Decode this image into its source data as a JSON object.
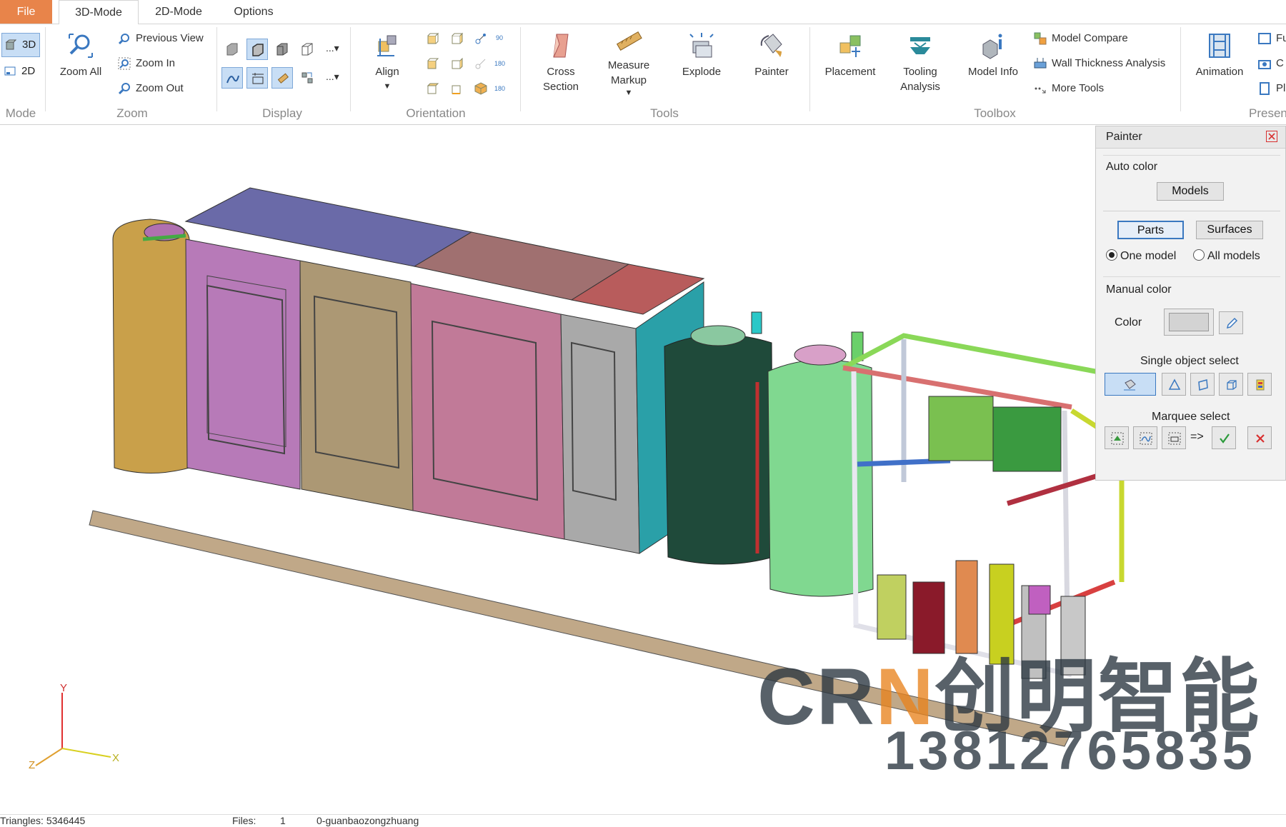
{
  "tabs": [
    {
      "label": "File"
    },
    {
      "label": "3D-Mode"
    },
    {
      "label": "2D-Mode"
    },
    {
      "label": "Options"
    }
  ],
  "ribbon": {
    "mode": {
      "label": "Mode",
      "btn_3d": "3D",
      "btn_2d": "2D"
    },
    "zoom": {
      "label": "Zoom",
      "zoom_all": "Zoom All",
      "previous_view": "Previous View",
      "zoom_in": "Zoom In",
      "zoom_out": "Zoom Out"
    },
    "display": {
      "label": "Display",
      "more": "..."
    },
    "orientation": {
      "label": "Orientation",
      "align": "Align",
      "deg90": "90",
      "deg180a": "180",
      "deg180b": "180"
    },
    "tools": {
      "label": "Tools",
      "cross_section": [
        "Cross",
        "Section"
      ],
      "measure_markup": [
        "Measure",
        "Markup"
      ],
      "explode": "Explode",
      "painter": "Painter"
    },
    "toolbox": {
      "label": "Toolbox",
      "placement": "Placement",
      "tooling_analysis": [
        "Tooling",
        "Analysis"
      ],
      "model_info": "Model Info",
      "model_compare": "Model Compare",
      "wall_thickness": "Wall Thickness Analysis",
      "more_tools": "More Tools"
    },
    "presentation": {
      "label": "Present",
      "animation": "Animation",
      "cut1": "Fu",
      "cut2": "C",
      "cut3": "Pl"
    }
  },
  "painter": {
    "title": "Painter",
    "auto_color": "Auto color",
    "models_btn": "Models",
    "parts_btn": "Parts",
    "surfaces_btn": "Surfaces",
    "one_model": "One model",
    "all_models": "All models",
    "manual_color": "Manual color",
    "color_label": "Color",
    "single_select": "Single object select",
    "marquee_select": "Marquee select",
    "arrow": "=>",
    "swatch_color": "#d3d3d3"
  },
  "axes": {
    "x": "X",
    "y": "Y",
    "z": "Z"
  },
  "status": {
    "triangles": "Triangles: 5346445",
    "files_label": "Files:",
    "files_count": "1",
    "file_name": "0-guanbaozongzhuang"
  },
  "watermark": {
    "brand_prefix": "CR",
    "brand_k": "N",
    "brand_cn": "创明智能",
    "phone": "13812765835"
  },
  "colors": {
    "accent": "#e8844a",
    "selection": "#c8def5",
    "ok": "#2a9a3a",
    "cancel": "#d83030"
  }
}
